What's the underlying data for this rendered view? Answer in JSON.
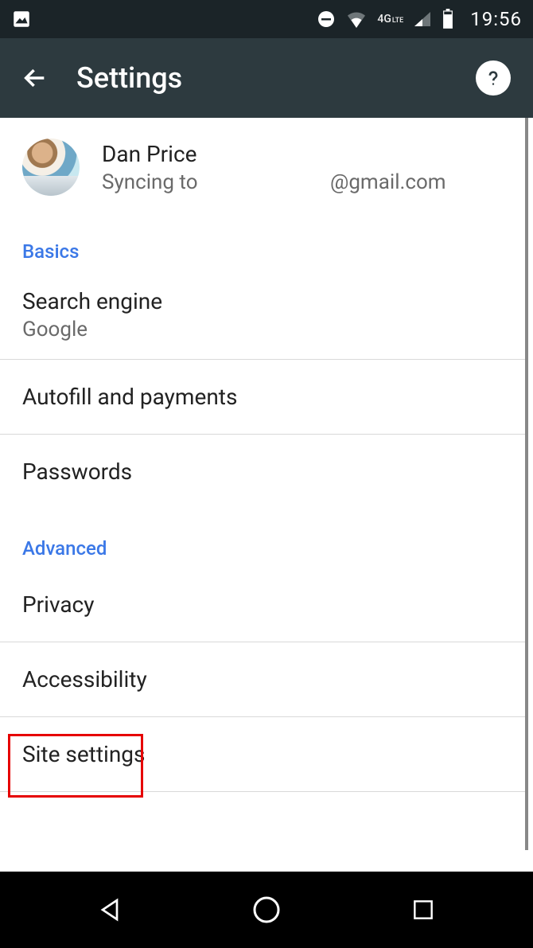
{
  "statusbar": {
    "network_label": "4G",
    "network_suffix": "LTE",
    "time": "19:56"
  },
  "appbar": {
    "title": "Settings"
  },
  "account": {
    "name": "Dan Price",
    "sync_prefix": "Syncing to",
    "email_domain": "@gmail.com"
  },
  "sections": {
    "basics": {
      "header": "Basics",
      "items": [
        {
          "title": "Search engine",
          "sub": "Google"
        },
        {
          "title": "Autofill and payments"
        },
        {
          "title": "Passwords"
        }
      ]
    },
    "advanced": {
      "header": "Advanced",
      "items": [
        {
          "title": "Privacy"
        },
        {
          "title": "Accessibility"
        },
        {
          "title": "Site settings"
        }
      ]
    }
  }
}
